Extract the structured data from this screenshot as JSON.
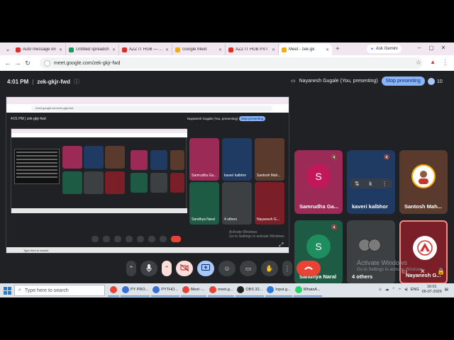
{
  "browser": {
    "tabs": [
      {
        "label": "Auto message on",
        "color": "#d93025"
      },
      {
        "label": "Untitled spreadsh",
        "color": "#0f9d58"
      },
      {
        "label": "AZZ IT HUB — Lo",
        "color": "#d93025"
      },
      {
        "label": "Google Meet",
        "color": "#f9ab00"
      },
      {
        "label": "AZZ IT HUB PVT",
        "color": "#d93025"
      },
      {
        "label": "Meet - zek-gk",
        "color": "#f9ab00"
      }
    ],
    "new_tab": "+",
    "ask_gemini": "Ask Gemini",
    "url": "meet.google.com/zek-gkjr-fwd",
    "minimize": "–",
    "restore": "▢",
    "close": "✕"
  },
  "meet": {
    "time": "4:01 PM",
    "separator": "|",
    "meeting_code": "zek-gkjr-fwd",
    "presenting_text": "Nayanesh Gugale (You, presenting)",
    "stop_presenting": "Stop presenting",
    "participant_count": "10",
    "participants": [
      {
        "name": "Samrudha Ga...",
        "initial": "S",
        "color": "#9b2a57",
        "avatar": "#c2185b",
        "kind": "initial"
      },
      {
        "name": "kaveri kalbhor",
        "initial": "k",
        "color": "#1f3a63",
        "avatar": "#3c4043",
        "kind": "hover"
      },
      {
        "name": "Santosh Mah...",
        "initial": "",
        "color": "#5b3a2e",
        "avatar": "#ffffff",
        "kind": "photo"
      },
      {
        "name": "Sandhya Naral",
        "initial": "S",
        "color": "#1e5b45",
        "avatar": "#1e8e5e",
        "kind": "initial"
      },
      {
        "name": "4 others",
        "initial": "",
        "color": "#3c4043",
        "avatar": "#7a7a7a",
        "kind": "others"
      },
      {
        "name": "Nayanesh G...",
        "initial": "",
        "color": "#7a1f27",
        "avatar": "#ffffff",
        "kind": "logo"
      }
    ],
    "hover_controls": [
      "⇅",
      "k",
      "⋮"
    ],
    "controls": {
      "more_down": "⌃",
      "mic": "🎤",
      "cam_chevron": "⌃",
      "camera_off": "⊘",
      "present": "⬆",
      "emoji": "☺",
      "captions": "▭",
      "raise_hand": "✋",
      "more": "⋮",
      "end_call": "☎"
    },
    "activate_title": "Activate Windows",
    "activate_sub": "Go to Settings to activate Windows."
  },
  "share": {
    "url": "meet.google.com/zek-gkjr-fwd",
    "time": "4:01 PM  |  zek-gkjr-fwd",
    "presenting": "Nayanesh Gugale (You, presenting)",
    "stop": "Stop presenting",
    "tiles": [
      {
        "name": "Samrudha Ga...",
        "color": "#9b2a57"
      },
      {
        "name": "kaveri kalbhor",
        "color": "#1f3a63"
      },
      {
        "name": "Santosh Mah...",
        "color": "#5b3a2e"
      },
      {
        "name": "Sandhya Naral",
        "color": "#1e5b45"
      },
      {
        "name": "4 others",
        "color": "#3c4043"
      },
      {
        "name": "Nayanesh G...",
        "color": "#7a1f27"
      }
    ],
    "taskbar_text": "Type here to search",
    "activate": "Activate Windows",
    "activate_sub": "Go to Settings to activate Windows."
  },
  "taskbar": {
    "search_placeholder": "Type here to search",
    "apps": [
      {
        "label": "",
        "color": "#ea4335"
      },
      {
        "label": "PY PRO...",
        "color": "#3b6fd4"
      },
      {
        "label": "PYTHO...",
        "color": "#3b6fd4"
      },
      {
        "label": "Meet -...",
        "color": "#ea4335"
      },
      {
        "label": "meet.g...",
        "color": "#ea4335"
      },
      {
        "label": "OBS 32...",
        "color": "#222222"
      },
      {
        "label": "Input.g...",
        "color": "#2b7bd6"
      },
      {
        "label": "WhatsA...",
        "color": "#25d366"
      }
    ],
    "language": "ENG",
    "time": "16:01",
    "date": "06-07-2026"
  }
}
